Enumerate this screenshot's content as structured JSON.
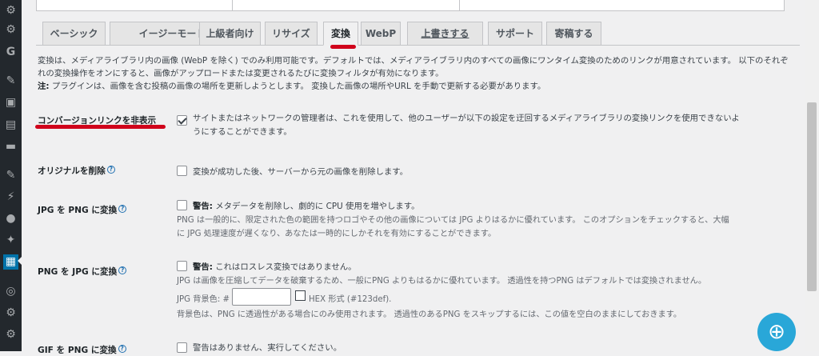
{
  "sidebar": {
    "icons": [
      {
        "name": "dashboard-gear-icon",
        "glyph": "⚙"
      },
      {
        "name": "g-plugin-icon",
        "glyph": "G"
      },
      {
        "name": "pin-icon",
        "glyph": "📌"
      },
      {
        "name": "media-icon",
        "glyph": "▣"
      },
      {
        "name": "pages-icon",
        "glyph": "▤"
      },
      {
        "name": "comments-icon",
        "glyph": "▬"
      },
      {
        "name": "appearance-icon",
        "glyph": "✎"
      },
      {
        "name": "plugins-icon",
        "glyph": "⚡"
      },
      {
        "name": "users-icon",
        "glyph": "●"
      },
      {
        "name": "tools-icon",
        "glyph": "✦"
      },
      {
        "name": "settings-active-icon",
        "glyph": "▦"
      },
      {
        "name": "circle-plugin-icon",
        "glyph": "◎"
      },
      {
        "name": "gear-icon-2",
        "glyph": "⚙"
      },
      {
        "name": "gear-icon-3",
        "glyph": "⚙"
      }
    ]
  },
  "tabs": [
    {
      "label": "ベーシック"
    },
    {
      "label": "イージーモード"
    },
    {
      "label": "上級者向け"
    },
    {
      "label": "リサイズ"
    },
    {
      "label": "変換"
    },
    {
      "label": "WebP"
    },
    {
      "label": "上書きする"
    },
    {
      "label": "サポート"
    },
    {
      "label": "寄稿する"
    }
  ],
  "intro": {
    "line1": "変換は、メディアライブラリ内の画像 (WebP を除く) でのみ利用可能です。デフォルトでは、メディアライブラリ内のすべての画像にワンタイム変換のためのリンクが用意されています。 以下のそれぞ",
    "line2": "れの変換操作をオンにすると、画像がアップロードまたは変更されるたびに変換フィルタが有効になります。",
    "note_label": "注:",
    "note_text": " プラグインは、画像を含む投稿の画像の場所を更新しようとします。 変換した画像の場所やURL を手動で更新する必要があります。"
  },
  "rows": {
    "hide_links": {
      "label": "コンバージョンリンクを非表示",
      "checked": true,
      "text": "サイトまたはネットワークの管理者は、これを使用して、他のユーザーが以下の設定を迂回するメディアライブラリの変換リンクを使用できないよ",
      "text2": "うにすることができます。"
    },
    "delete_originals": {
      "label": "オリジナルを削除",
      "checked": false,
      "text": "変換が成功した後、サーバーから元の画像を削除します。"
    },
    "jpg_to_png": {
      "label": "JPG を PNG に変換",
      "checked": false,
      "warn": "警告:",
      "text": " メタデータを削除し、劇的に CPU 使用を増やします。",
      "desc1": "PNG は一般的に、限定された色の範囲を持つロゴやその他の画像については JPG よりはるかに優れています。 このオプションをチェックすると、大幅",
      "desc2": "に JPG 処理速度が遅くなり、あなたは一時的にしかそれを有効にすることができます。"
    },
    "png_to_jpg": {
      "label": "PNG を JPG に変換",
      "checked": false,
      "warn": "警告:",
      "text": " これはロスレス変換ではありません。",
      "desc1": "JPG は画像を圧縮してデータを破棄するため、一般にPNG よりもはるかに優れています。 透過性を持つPNG はデフォルトでは変換されません。",
      "bg_label": "JPG 背景色: #",
      "bg_value": "",
      "hex_label": "HEX 形式 (#123def).",
      "desc2": "背景色は、PNG に透過性がある場合にのみ使用されます。 透過性のあるPNG をスキップするには、この値を空白のままにしておきます。"
    },
    "gif_to_png": {
      "label": "GIF を PNG に変換",
      "checked": false,
      "text": "警告はありません、実行してください。"
    }
  },
  "help_button": {
    "glyph": "⊕"
  }
}
